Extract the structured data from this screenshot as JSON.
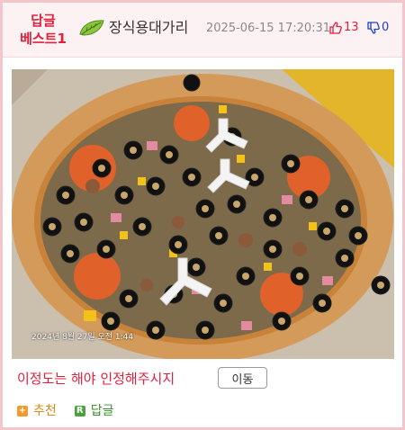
{
  "post": {
    "badge": "답글\n베스트1",
    "badge_line1": "답글",
    "badge_line2": "베스트1",
    "level_icon": "green-leaf-level-icon",
    "username": "장식용대가리",
    "timestamp": "2025-06-15 17:20:31",
    "upvotes": "13",
    "downvotes": "0",
    "photo_stamp": "2024년 8월 27일 오전 1:44",
    "comment": "이정도는 해야 인정해주시지",
    "move_button": "이동",
    "recommend_label": "추천",
    "reply_label": "답글"
  },
  "colors": {
    "accent_red": "#e0203c",
    "downvote_blue": "#1a3fc8",
    "recommend_orange": "#f29a2b",
    "reply_green": "#4aa33a",
    "border_pink": "#f3c6cc"
  },
  "icons": {
    "upvote": "thumbs-up-icon",
    "downvote": "thumbs-down-icon",
    "recommend": "plus-icon",
    "reply": "reply-r-icon"
  }
}
